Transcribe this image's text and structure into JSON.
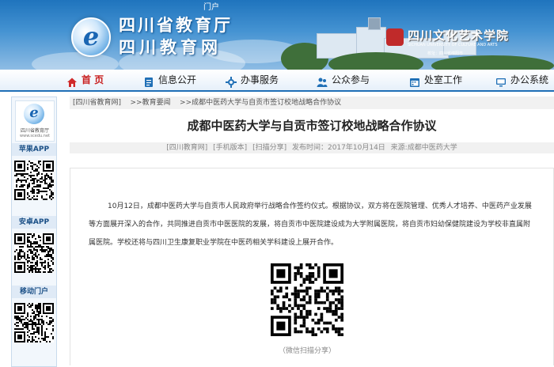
{
  "banner": {
    "top_fragment": "门户",
    "title_line1": "四川省教育厅",
    "title_line2": "四川教育网",
    "art_school_name": "四川文化艺术学院",
    "art_school_en": "SICHUAN UNIVERSITY OF CULTURE AND ARTS",
    "art_school_address": "校址：四川省绵阳市"
  },
  "nav": {
    "items": [
      {
        "label": "首 页",
        "icon": "home-icon",
        "active": true
      },
      {
        "label": "信息公开",
        "icon": "document-icon",
        "active": false
      },
      {
        "label": "办事服务",
        "icon": "service-icon",
        "active": false
      },
      {
        "label": "公众参与",
        "icon": "people-icon",
        "active": false
      },
      {
        "label": "处室工作",
        "icon": "calendar-icon",
        "active": false
      },
      {
        "label": "办公系统",
        "icon": "monitor-icon",
        "active": false
      }
    ]
  },
  "sidebar": {
    "logo_name": "四川省教育厅",
    "logo_url": "www.scedu.net",
    "sections": [
      {
        "label": "苹果APP"
      },
      {
        "label": "安卓APP"
      },
      {
        "label": "移动门户"
      }
    ]
  },
  "breadcrumb": {
    "items": [
      "[四川省教育网]",
      ">>教育要闻",
      ">>成都中医药大学与自贡市签订校地战略合作协议"
    ]
  },
  "article": {
    "title": "成都中医药大学与自贡市签订校地战略合作协议",
    "meta": {
      "site": "[四川教育网]",
      "mobile": "[手机版本]",
      "share": "[扫描分享]",
      "published": "发布时间：2017年10月14日",
      "source": "来源:成都中医药大学"
    },
    "body": "10月12日，成都中医药大学与自贡市人民政府举行战略合作签约仪式。根据协议，双方将在医院管理、优秀人才培养、中医药产业发展等方面展开深入的合作，共同推进自贡市中医医院的发展，将自贡市中医院建设成为大学附属医院，将自贡市妇幼保健院建设为学校非直属附属医院。学校还将与四川卫生康复职业学院在中医药相关学科建设上展开合作。",
    "qr_caption": "（微信扫描分享）"
  },
  "colors": {
    "banner_blue": "#1f74bd",
    "nav_active": "#c81e1e",
    "nav_border": "#1f6fb6",
    "sidebar_label": "#1a4f86"
  }
}
